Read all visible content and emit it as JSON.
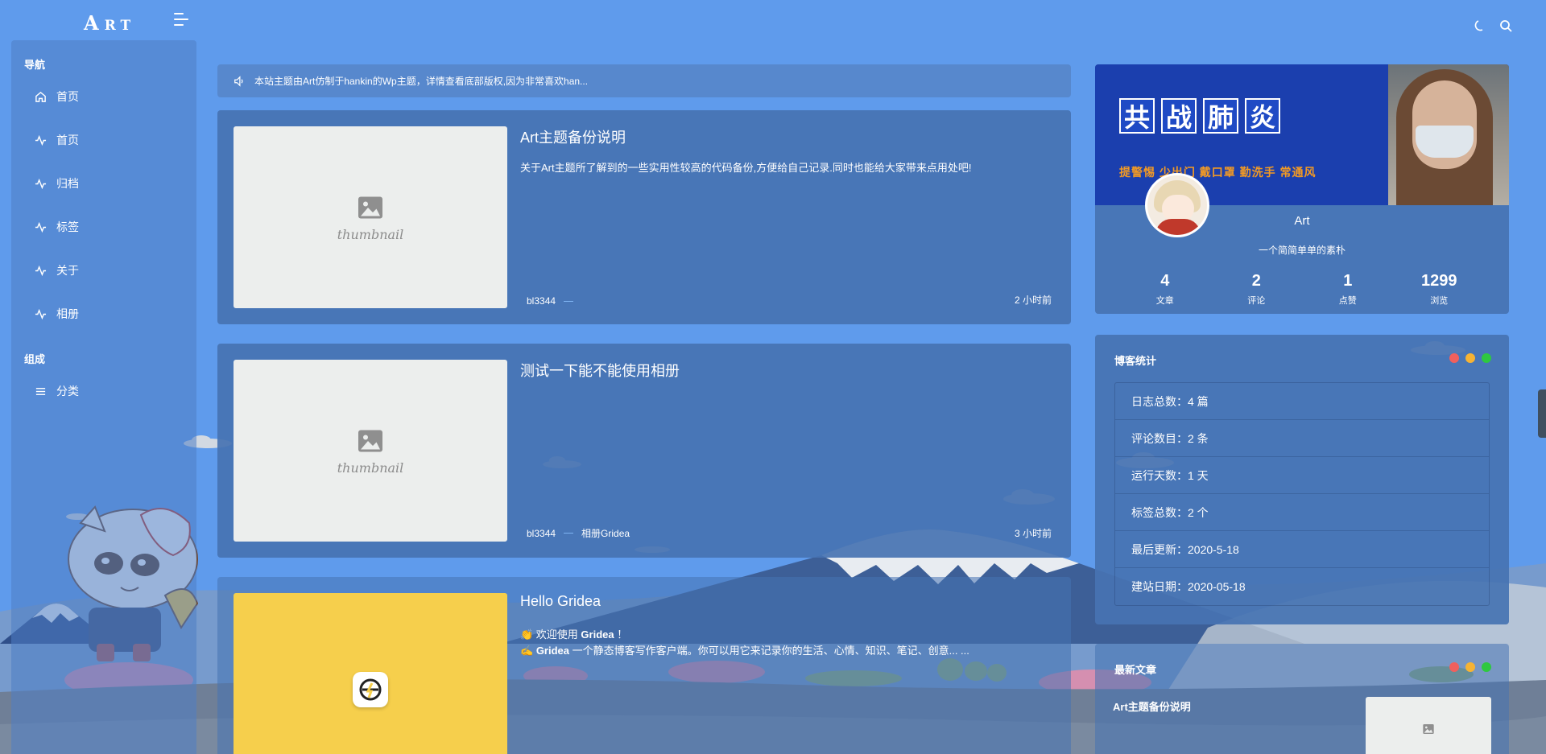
{
  "site": {
    "logo_big": "A",
    "logo_small": "RT",
    "accent": "#5f9bec"
  },
  "header": {
    "icons": [
      "moon-icon",
      "search-icon"
    ]
  },
  "sidebar": {
    "group_nav": "导航",
    "items": [
      {
        "label": "首页",
        "icon": "home-icon"
      },
      {
        "label": "首页",
        "icon": "activity-icon"
      },
      {
        "label": "归档",
        "icon": "activity-icon"
      },
      {
        "label": "标签",
        "icon": "activity-icon"
      },
      {
        "label": "关于",
        "icon": "activity-icon"
      },
      {
        "label": "相册",
        "icon": "activity-icon"
      }
    ],
    "group_compose": "组成",
    "compose_items": [
      {
        "label": "分类",
        "icon": "list-icon"
      }
    ]
  },
  "notice": {
    "text": "本站主题由Art仿制于hankin的Wp主题，详情查看底部版权,因为非常喜欢han..."
  },
  "posts": [
    {
      "title": "Art主题备份说明",
      "excerpt": "关于Art主题所了解到的一些实用性较高的代码备份,方便给自己记录.同时也能给大家带来点用处吧!",
      "author": "bl3344",
      "category": "",
      "time": "2 小时前",
      "thumb_text": "thumbnail"
    },
    {
      "title": "测试一下能不能使用相册",
      "excerpt": "",
      "author": "bl3344",
      "category": "相册Gridea",
      "time": "3 小时前",
      "thumb_text": "thumbnail"
    },
    {
      "title": "Hello Gridea",
      "excerpt_line1_prefix": "👏 欢迎使用 ",
      "excerpt_line1_bold": "Gridea",
      "excerpt_line1_suffix": " ！",
      "excerpt_line2_prefix": "✍️ ",
      "excerpt_line2_bold": "Gridea",
      "excerpt_line2_suffix": " 一个静态博客写作客户端。你可以用它来记录你的生活、心情、知识、笔记、创意... ..."
    }
  ],
  "profile": {
    "banner_chars": [
      "共",
      "战",
      "肺",
      "炎"
    ],
    "banner_slogan": "提警惕 少出门 戴口罩 勤洗手 常通风",
    "name": "Art",
    "desc": "一个简简单单的素朴",
    "stats": [
      {
        "value": "4",
        "label": "文章"
      },
      {
        "value": "2",
        "label": "评论"
      },
      {
        "value": "1",
        "label": "点赞"
      },
      {
        "value": "1299",
        "label": "浏览"
      }
    ]
  },
  "blog_stats": {
    "title": "博客统计",
    "rows": [
      "日志总数：4 篇",
      "评论数目：2 条",
      "运行天数：1 天",
      "标签总数：2 个",
      "最后更新：2020-5-18",
      "建站日期：2020-05-18"
    ],
    "dot_colors": [
      "#f0605d",
      "#f6b334",
      "#2ec840"
    ]
  },
  "latest": {
    "title": "最新文章",
    "items": [
      {
        "title": "Art主题备份说明"
      }
    ]
  }
}
